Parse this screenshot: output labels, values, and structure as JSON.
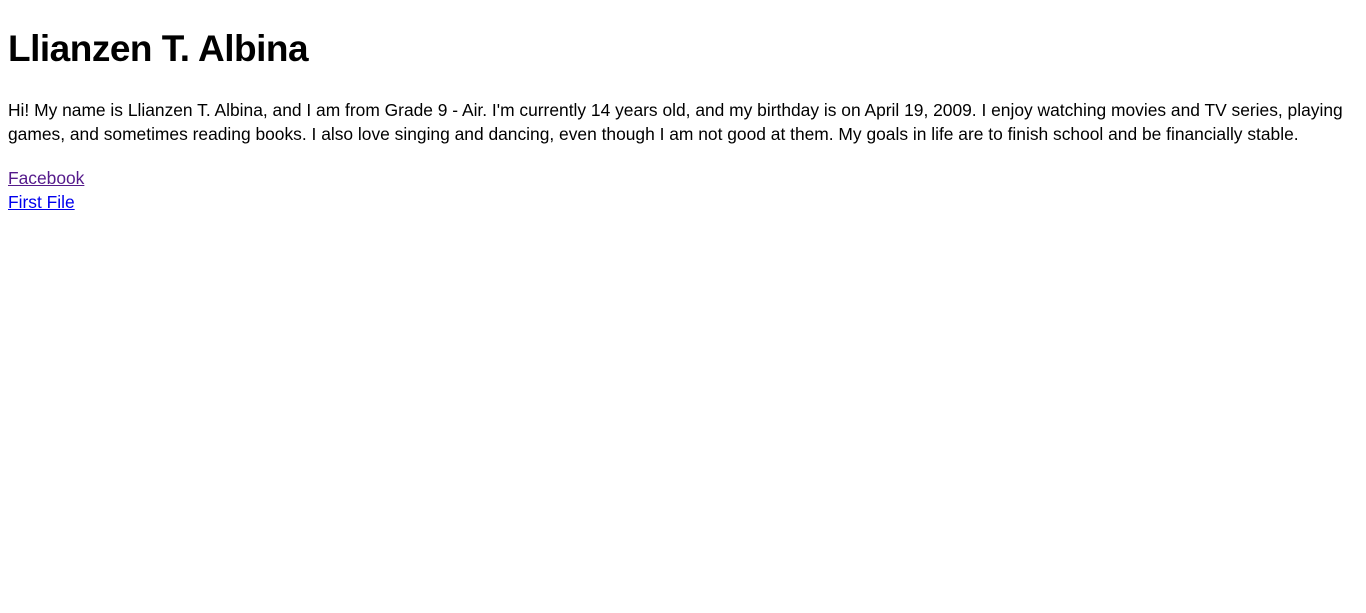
{
  "page": {
    "title": "Llianzen T. Albina",
    "bio": "Hi! My name is Llianzen T. Albina, and I am from Grade 9 - Air. I'm currently 14 years old, and my birthday is on April 19, 2009. I enjoy watching movies and TV series, playing games, and sometimes reading books. I also love singing and dancing, even though I am not good at them. My goals in life are to finish school and be financially stable."
  },
  "links": [
    {
      "label": "Facebook",
      "color": "#551a8b"
    },
    {
      "label": "First File",
      "color": "#0000ee"
    }
  ]
}
